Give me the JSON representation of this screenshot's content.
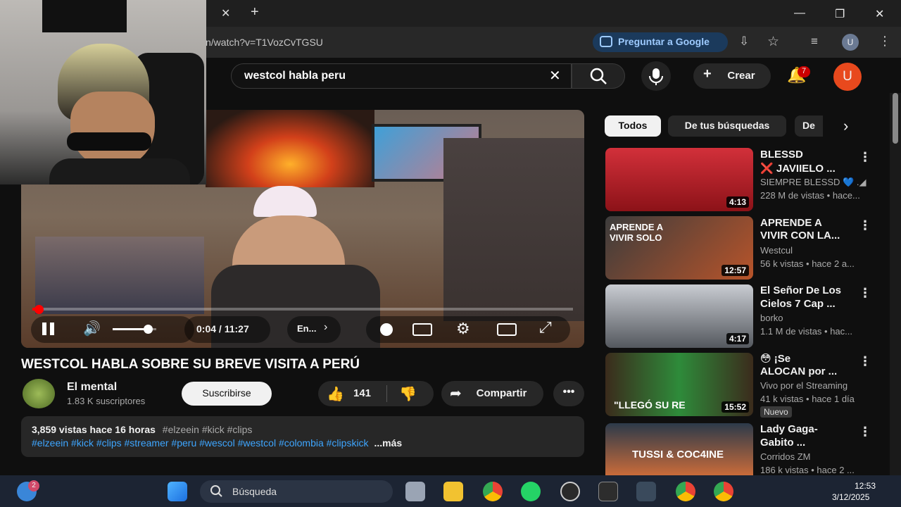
{
  "browser": {
    "url": "n/watch?v=T1VozCvTGSU",
    "ask_google_label": "Preguntar a Google",
    "profile_initial": "U",
    "new_tab": "+"
  },
  "youtube": {
    "search_query": "westcol habla peru",
    "create_label": "Crear",
    "notification_count": "7",
    "avatar_initial": "U"
  },
  "player": {
    "time": "0:04 / 11:27",
    "lang": "En...",
    "progress_fraction": 0.006,
    "volume_fraction": 0.8
  },
  "video": {
    "title": "WESTCOL HABLA SOBRE SU BREVE VISITA A PERÚ",
    "channel": "El mental",
    "subscribers": "1.83 K suscriptores",
    "subscribe_label": "Suscribirse",
    "likes": "141",
    "share_label": "Compartir",
    "desc_stats": "3,859 vistas  hace 16 horas",
    "desc_tags_inline": "#elzeein #kick #clips",
    "desc_tags": "#elzeein #kick #clips #streamer #peru #wescol #westcol #colombia #clipskick",
    "more_label": "...más"
  },
  "chips": [
    "Todos",
    "De tus búsquedas",
    "De"
  ],
  "sidebar": [
    {
      "title1": "BLESSD",
      "title2": "❌ JAVIIELO ...",
      "channel": "SIEMPRE BLESSD 💙 .◢",
      "meta": "228 M de vistas • hace...",
      "duration": "4:13",
      "thumb": "#b8202a"
    },
    {
      "title1": "APRENDE A",
      "title2": "VIVIR CON LA...",
      "channel": "Westcul",
      "meta": "56 k vistas • hace 2 a...",
      "duration": "12:57",
      "thumb": "#3a3a3a",
      "thumb_text": "APRENDE A VIVIR SOLO"
    },
    {
      "title1": "El Señor De Los",
      "title2": "Cielos 7 Cap ...",
      "channel": "borko",
      "meta": "1.1 M de vistas • hac...",
      "duration": "4:17",
      "thumb": "#7a7f86"
    },
    {
      "title1": "😳 ¡Se",
      "title2": "ALOCAN por ...",
      "channel": "Vivo por el Streaming",
      "meta": "41 k vistas • hace 1 día",
      "badge": "Nuevo",
      "duration": "15:52",
      "thumb": "#2e8b3a",
      "thumb_text": "\"LLEGÓ SU RE"
    },
    {
      "title1": "Lady Gaga-",
      "title2": "Gabito ...",
      "channel": "Corridos ZM",
      "meta": "186 k vistas • hace 2 ...",
      "thumb": "#c96b3a",
      "thumb_text": "TUSSI & COC4INE"
    }
  ],
  "taskbar": {
    "search_placeholder": "Búsqueda",
    "time": "12:53",
    "date": "3/12/2025",
    "widget_badge": "2"
  },
  "colors": {
    "red": "#ff0000",
    "link": "#3ea6ff",
    "accent": "#cc0000"
  }
}
